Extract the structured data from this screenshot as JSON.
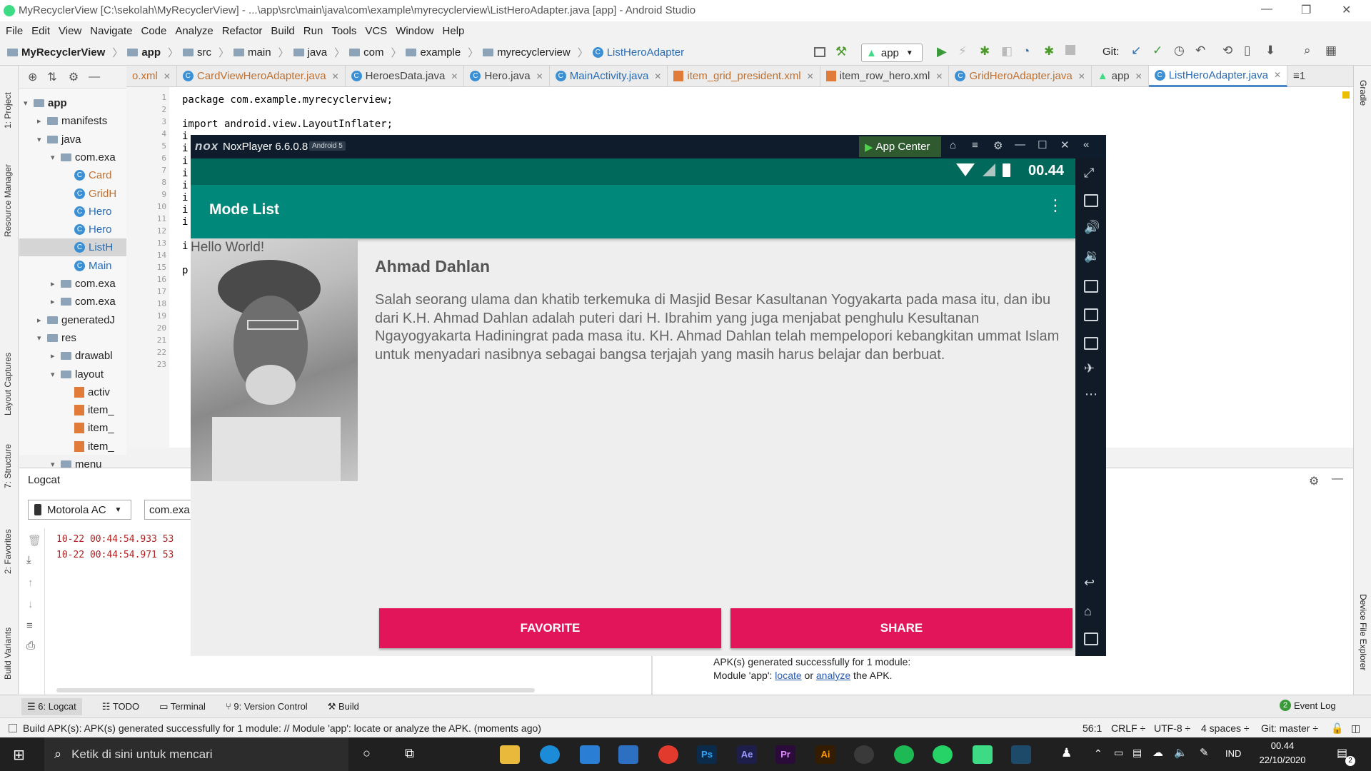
{
  "window": {
    "title": "MyRecyclerView [C:\\sekolah\\MyRecyclerView] - ...\\app\\src\\main\\java\\com\\example\\myrecyclerview\\ListHeroAdapter.java [app] - Android Studio",
    "controls": [
      "—",
      "❐",
      "✕"
    ]
  },
  "menu": [
    "File",
    "Edit",
    "View",
    "Navigate",
    "Code",
    "Analyze",
    "Refactor",
    "Build",
    "Run",
    "Tools",
    "VCS",
    "Window",
    "Help"
  ],
  "breadcrumb": [
    "MyRecyclerView",
    "app",
    "src",
    "main",
    "java",
    "com",
    "example",
    "myrecyclerview",
    "ListHeroAdapter"
  ],
  "run_config": "app",
  "git_label": "Git:",
  "editor_tabs": [
    {
      "label": "o.xml",
      "active": false
    },
    {
      "label": "CardViewHeroAdapter.java",
      "active": false
    },
    {
      "label": "HeroesData.java",
      "active": false
    },
    {
      "label": "Hero.java",
      "active": false
    },
    {
      "label": "MainActivity.java",
      "active": false
    },
    {
      "label": "item_grid_president.xml",
      "active": false
    },
    {
      "label": "item_row_hero.xml",
      "active": false
    },
    {
      "label": "GridHeroAdapter.java",
      "active": false
    },
    {
      "label": "app",
      "active": false
    },
    {
      "label": "ListHeroAdapter.java",
      "active": true
    }
  ],
  "tabs_overflow": "≡1",
  "project_tree": [
    {
      "label": "app",
      "indent": 0,
      "icon": "folder",
      "arrow": "▾"
    },
    {
      "label": "manifests",
      "indent": 1,
      "icon": "folder",
      "arrow": "▸"
    },
    {
      "label": "java",
      "indent": 1,
      "icon": "folder",
      "arrow": "▾"
    },
    {
      "label": "com.exa",
      "indent": 2,
      "icon": "folder",
      "arrow": "▾"
    },
    {
      "label": "Card",
      "indent": 3,
      "icon": "class",
      "arrow": ""
    },
    {
      "label": "GridH",
      "indent": 3,
      "icon": "class",
      "arrow": ""
    },
    {
      "label": "Hero",
      "indent": 3,
      "icon": "class",
      "arrow": ""
    },
    {
      "label": "Hero",
      "indent": 3,
      "icon": "class",
      "arrow": ""
    },
    {
      "label": "ListH",
      "indent": 3,
      "icon": "class",
      "arrow": "",
      "selected": true
    },
    {
      "label": "Main",
      "indent": 3,
      "icon": "class",
      "arrow": ""
    },
    {
      "label": "com.exa",
      "indent": 2,
      "icon": "folder",
      "arrow": "▸"
    },
    {
      "label": "com.exa",
      "indent": 2,
      "icon": "folder",
      "arrow": "▸"
    },
    {
      "label": "generatedJ",
      "indent": 1,
      "icon": "folder",
      "arrow": "▸"
    },
    {
      "label": "res",
      "indent": 1,
      "icon": "folder",
      "arrow": "▾"
    },
    {
      "label": "drawabl",
      "indent": 2,
      "icon": "folder",
      "arrow": "▸"
    },
    {
      "label": "layout",
      "indent": 2,
      "icon": "folder",
      "arrow": "▾"
    },
    {
      "label": "activ",
      "indent": 3,
      "icon": "xml",
      "arrow": ""
    },
    {
      "label": "item_",
      "indent": 3,
      "icon": "xml",
      "arrow": ""
    },
    {
      "label": "item_",
      "indent": 3,
      "icon": "xml",
      "arrow": ""
    },
    {
      "label": "item_",
      "indent": 3,
      "icon": "xml",
      "arrow": ""
    },
    {
      "label": "menu",
      "indent": 2,
      "icon": "folder",
      "arrow": "▾"
    }
  ],
  "code": {
    "line_numbers": [
      "1",
      "2",
      "3",
      "4",
      "5",
      "6",
      "7",
      "8",
      "9",
      "10",
      "11",
      "12",
      "13",
      "14",
      "15",
      "16",
      "17",
      "18",
      "19",
      "20",
      "21",
      "22",
      "23"
    ],
    "lines": [
      "package com.example.myrecyclerview;",
      "",
      "import android.view.LayoutInflater;",
      "i",
      "i",
      "i",
      "i",
      "i",
      "i",
      "i",
      "i",
      "",
      "i",
      "",
      "p"
    ]
  },
  "left_vertical_tabs": [
    "1: Project",
    "Resource Manager",
    "Layout Captures",
    "7: Structure",
    "2: Favorites",
    "Build Variants"
  ],
  "right_vertical_tabs": [
    "Gradle",
    "Device File Explorer"
  ],
  "logcat": {
    "title": "Logcat",
    "device": "Motorola AC",
    "package": "com.exa",
    "lines": [
      "10-22 00:44:54.933 53",
      "10-22 00:44:54.971 53"
    ]
  },
  "build_output": {
    "line1": "APK(s) generated successfully for 1 module:",
    "line2_prefix": "Module 'app': ",
    "locate": "locate",
    "or": " or ",
    "analyze": "analyze",
    "line2_suffix": " the APK."
  },
  "tool_tabs": [
    "6: Logcat",
    "TODO",
    "Terminal",
    "9: Version Control",
    "Build"
  ],
  "event_log": {
    "count": "2",
    "label": "Event Log"
  },
  "status": {
    "message": "Build APK(s): APK(s) generated successfully for 1 module: // Module 'app': locate or analyze the APK. (moments ago)",
    "position": "56:1",
    "line_sep": "CRLF ÷",
    "encoding": "UTF-8 ÷",
    "indent": "4 spaces ÷",
    "git": "Git: master ÷"
  },
  "nox": {
    "brand": "nox",
    "version": "NoxPlayer 6.6.0.8",
    "android_badge": "Android 5",
    "app_center": "App Center",
    "clock": "00.44",
    "app_title": "Mode List",
    "hello": "Hello World!",
    "hero_name": "Ahmad Dahlan",
    "hero_desc": "Salah seorang ulama dan khatib terkemuka di Masjid Besar Kasultanan Yogyakarta pada masa itu, dan ibu dari K.H. Ahmad Dahlan adalah puteri dari H. Ibrahim yang juga menjabat penghulu Kesultanan Ngayogyakarta Hadiningrat pada masa itu. KH. Ahmad Dahlan telah mempelopori kebangkitan ummat Islam untuk menyadari nasibnya sebagai bangsa terjajah yang masih harus belajar dan berbuat.",
    "favorite": "FAVORITE",
    "share": "SHARE",
    "accent": "#e2145a",
    "primary": "#00897b",
    "primary_dark": "#00695c"
  },
  "taskbar": {
    "search_placeholder": "Ketik di sini untuk mencari",
    "apps": [
      "file-explorer-icon",
      "edge-icon",
      "vscode-icon",
      "mail-icon",
      "chrome-icon",
      "photoshop-icon",
      "after-effects-icon",
      "premiere-icon",
      "illustrator-icon",
      "xbox-icon",
      "spotify-icon",
      "whatsapp-icon",
      "android-studio-icon",
      "nox-icon"
    ],
    "app_labels": {
      "ps": "Ps",
      "ae": "Ae",
      "pr": "Pr",
      "ai": "Ai"
    },
    "lang": "IND",
    "time": "00.44",
    "date": "22/10/2020",
    "notif_count": "2"
  }
}
